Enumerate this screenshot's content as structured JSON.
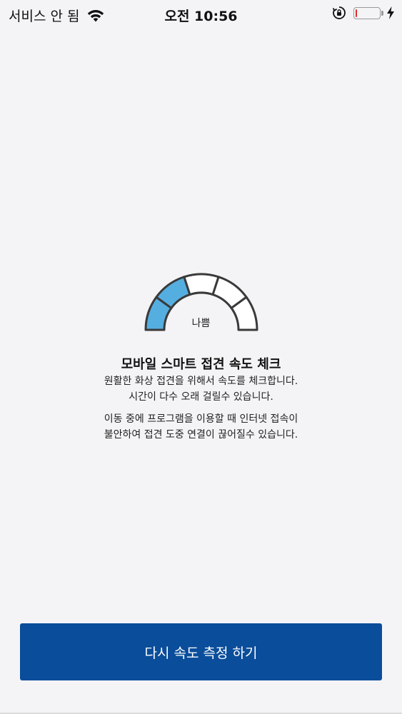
{
  "status_bar": {
    "carrier": "서비스 안 됨",
    "time": "오전 10:56",
    "battery_level": 0.08,
    "icons": {
      "wifi": "wifi-icon",
      "lock": "orientation-lock-icon",
      "battery": "battery-icon",
      "charging": "charging-bolt-icon"
    },
    "battery_color": "#e0302a"
  },
  "gauge": {
    "label": "나쁨",
    "segments_total": 5,
    "segments_active": 2,
    "active_color": "#55aee0",
    "inactive_color": "#ffffff",
    "stroke_color": "#3a3a3a"
  },
  "content": {
    "title": "모바일 스마트 접견 속도 체크",
    "desc1_line1": "원활한 화상 접견을 위해서 속도를 체크합니다.",
    "desc1_line2": "시간이 다수 오래 걸릴수 있습니다.",
    "desc2_line1": "이동 중에 프로그램을 이용할 때 인터넷 접속이",
    "desc2_line2": "불안하여 접견 도중 연결이 끊어질수 있습니다."
  },
  "actions": {
    "retest_label": "다시 속도 측정 하기",
    "button_color": "#0a4d9b"
  }
}
